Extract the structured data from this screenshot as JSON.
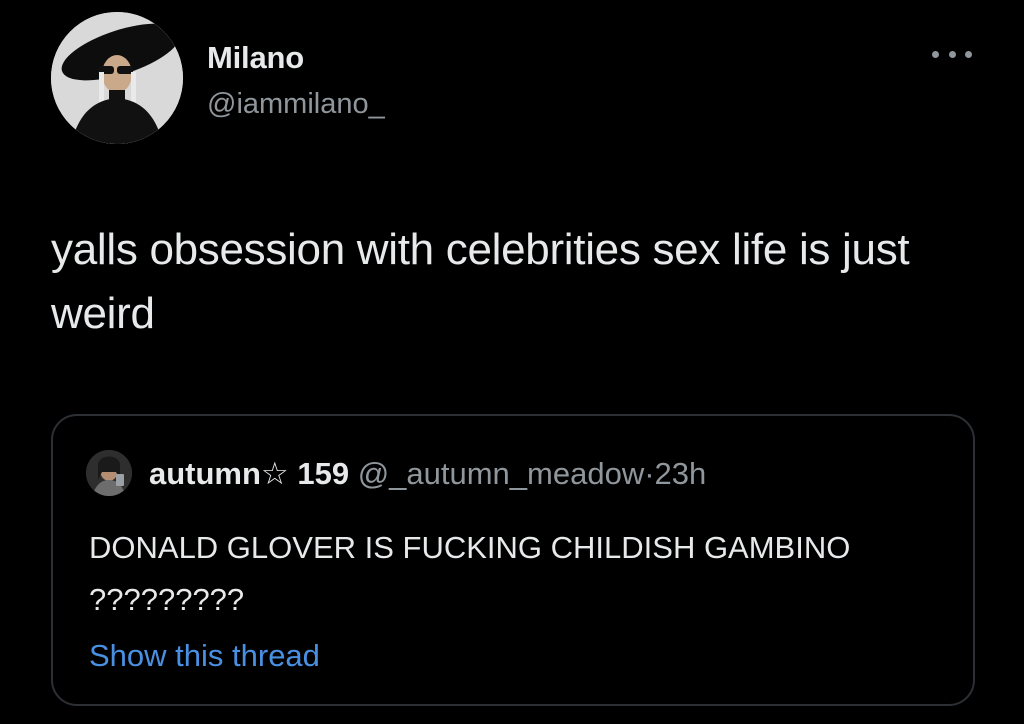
{
  "author": {
    "display_name": "Milano",
    "handle": "@iammilano_",
    "avatar_icon": "profile-photo"
  },
  "tweet": {
    "text": "yalls obsession with celebrities sex life is just weird"
  },
  "menu": {
    "icon": "more-options-icon"
  },
  "quoted_tweet": {
    "display_name": "autumn☆ 159",
    "handle": "@_autumn_meadow",
    "separator": "·",
    "time": "23h",
    "text": "DONALD GLOVER IS FUCKING CHILDISH GAMBINO ?????????",
    "show_thread": "Show this thread",
    "avatar_icon": "profile-photo"
  },
  "colors": {
    "background": "#000000",
    "text": "#e7e9ea",
    "secondary": "#8f969c",
    "link": "#4a90e2",
    "border": "#2c2f33"
  }
}
